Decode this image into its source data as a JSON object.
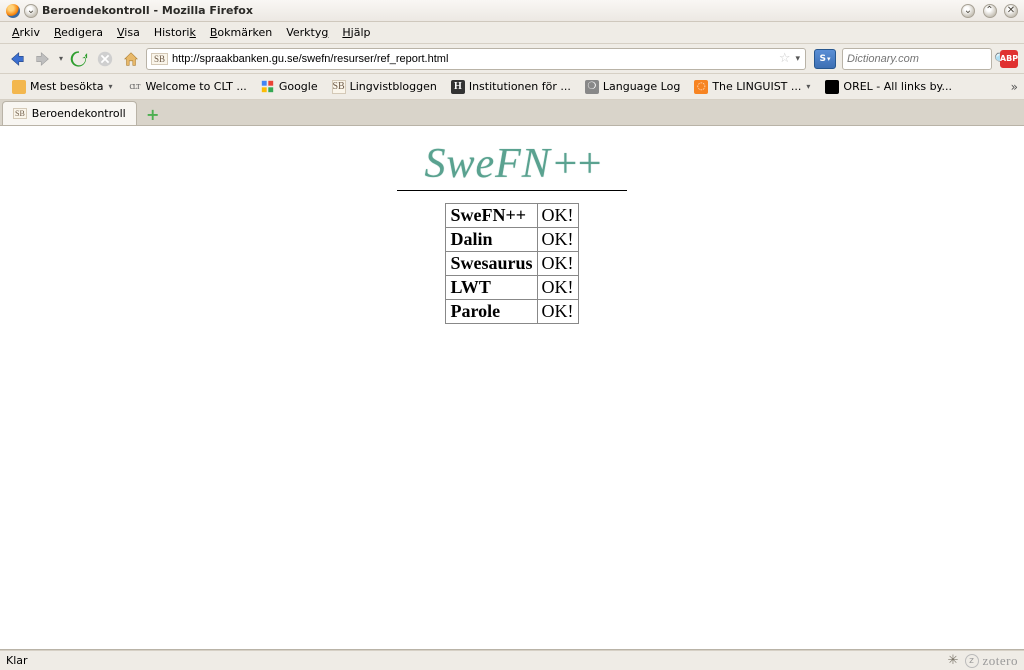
{
  "window": {
    "title": "Beroendekontroll - Mozilla Firefox"
  },
  "menu": {
    "file": {
      "pre": "",
      "u": "A",
      "post": "rkiv"
    },
    "edit": {
      "pre": "",
      "u": "R",
      "post": "edigera"
    },
    "view": {
      "pre": "",
      "u": "V",
      "post": "isa"
    },
    "history": {
      "pre": "Histori",
      "u": "k",
      "post": ""
    },
    "bookmarks": {
      "pre": "",
      "u": "B",
      "post": "okmärken"
    },
    "tools": {
      "pre": "Verkty",
      "u": "g",
      "post": ""
    },
    "help": {
      "pre": "",
      "u": "H",
      "post": "jälp"
    }
  },
  "nav": {
    "url": "http://spraakbanken.gu.se/swefn/resurser/ref_report.html",
    "search_placeholder": "Dictionary.com",
    "favicon_label": "SB",
    "search_engine_label": "S",
    "abp_label": "ABP"
  },
  "bookmarks": {
    "most_visited": "Mest besökta",
    "clt": "Welcome to CLT ...",
    "google": "Google",
    "ling": "Lingvistbloggen",
    "inst": "Institutionen för ...",
    "langlog": "Language Log",
    "linguist": "The LINGUIST ...",
    "orel": "OREL - All links by..."
  },
  "tabs": {
    "t0": "Beroendekontroll"
  },
  "page": {
    "brand_main": "SweFN",
    "brand_suffix": "++",
    "rows": [
      {
        "name": "SweFN++",
        "status": "OK!"
      },
      {
        "name": "Dalin",
        "status": "OK!"
      },
      {
        "name": "Swesaurus",
        "status": "OK!"
      },
      {
        "name": "LWT",
        "status": "OK!"
      },
      {
        "name": "Parole",
        "status": "OK!"
      }
    ]
  },
  "status": {
    "text": "Klar",
    "zotero": "zotero",
    "zotero_mark": "z"
  }
}
